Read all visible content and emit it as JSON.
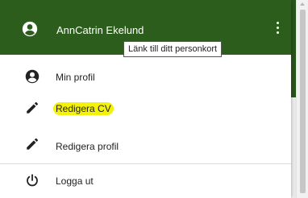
{
  "header": {
    "user_name": "AnnCatrin Ekelund",
    "tooltip": "Länk till ditt personkort",
    "bg_color": "#2c5d1d"
  },
  "menu": {
    "items": [
      {
        "label": "Min profil",
        "icon": "account-circle-icon"
      },
      {
        "label": "Redigera CV",
        "icon": "pencil-icon",
        "highlighted": true
      },
      {
        "label": "Redigera profil",
        "icon": "pencil-icon"
      },
      {
        "label": "Logga ut",
        "icon": "power-icon"
      }
    ]
  },
  "highlight_color": "#f5f20a"
}
